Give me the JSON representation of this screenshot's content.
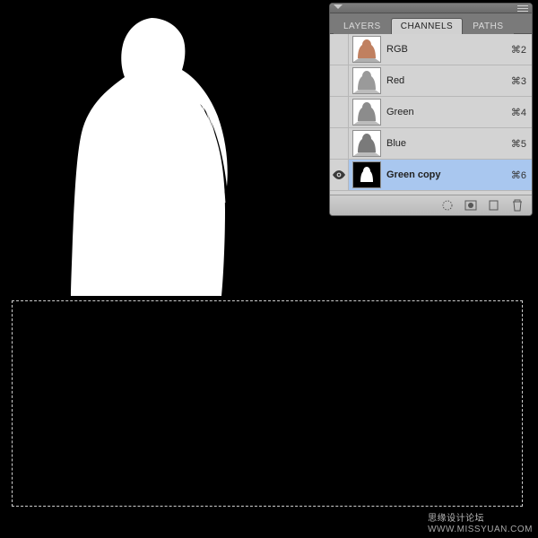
{
  "panel": {
    "tabs": [
      {
        "label": "LAYERS",
        "active": false
      },
      {
        "label": "CHANNELS",
        "active": true
      },
      {
        "label": "PATHS",
        "active": false
      }
    ],
    "channels": [
      {
        "name": "RGB",
        "shortcut": "⌘2",
        "visible": false,
        "selected": false,
        "thumb": "color"
      },
      {
        "name": "Red",
        "shortcut": "⌘3",
        "visible": false,
        "selected": false,
        "thumb": "gray"
      },
      {
        "name": "Green",
        "shortcut": "⌘4",
        "visible": false,
        "selected": false,
        "thumb": "gray"
      },
      {
        "name": "Blue",
        "shortcut": "⌘5",
        "visible": false,
        "selected": false,
        "thumb": "gray"
      },
      {
        "name": "Green copy",
        "shortcut": "⌘6",
        "visible": true,
        "selected": true,
        "thumb": "mask"
      }
    ],
    "footer_icons": [
      "load-selection-icon",
      "save-selection-icon",
      "new-channel-icon",
      "delete-channel-icon"
    ]
  },
  "watermark": {
    "line1": "思缘设计论坛",
    "line2": "WWW.MISSYUAN.COM"
  }
}
